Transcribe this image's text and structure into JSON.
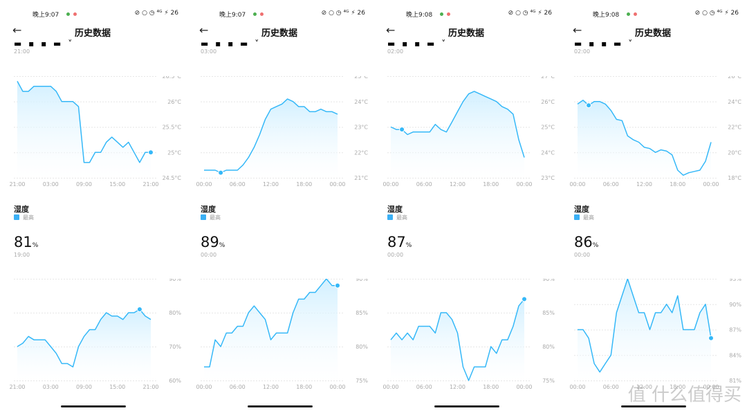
{
  "app": {
    "title": "历史数据",
    "humidity_title": "湿度",
    "legend_max": "最高",
    "humidity_unit": "%",
    "battery": "26",
    "status_icons": "⊘ ○ ◷ ⁴ᴳ ⚡"
  },
  "colors": {
    "line": "#35b8f8",
    "fill_top": "#cdeeff",
    "grid": "#e6e6e6",
    "legend": "#3bb0f5",
    "dot_green": "#4caf50",
    "dot_red": "#ef7070"
  },
  "watermark": "值 什么值得买",
  "panels": [
    {
      "status_time": "晚上9:07",
      "temp_top_time": "21:00",
      "temp_chart": {
        "type": "line",
        "y_ticks": [
          "26.5°C",
          "26°C",
          "25.5°C",
          "25°C",
          "24.5°C"
        ],
        "ylim": [
          24.5,
          26.5
        ],
        "x_ticks": [
          "21:00",
          "03:00",
          "09:00",
          "15:00",
          "21:00"
        ],
        "values": [
          26.4,
          26.2,
          26.2,
          26.3,
          26.3,
          26.3,
          26.3,
          26.2,
          26.0,
          26.0,
          26.0,
          25.9,
          24.8,
          24.8,
          25.0,
          25.0,
          25.2,
          25.3,
          25.2,
          25.1,
          25.2,
          25.0,
          24.8,
          25.0,
          25.0
        ],
        "marker_index": 24
      },
      "humidity_value": "81",
      "humidity_time": "19:00",
      "hum_chart": {
        "type": "line",
        "y_ticks": [
          "90%",
          "80%",
          "70%",
          "60%"
        ],
        "ylim": [
          60,
          90
        ],
        "x_ticks": [
          "21:00",
          "03:00",
          "09:00",
          "15:00",
          "21:00"
        ],
        "values": [
          70,
          71,
          73,
          72,
          72,
          72,
          70,
          68,
          65,
          65,
          64,
          70,
          73,
          75,
          75,
          78,
          80,
          79,
          79,
          78,
          80,
          80,
          81,
          79,
          78
        ],
        "marker_index": 22
      }
    },
    {
      "status_time": "晚上9:07",
      "temp_top_time": "03:00",
      "temp_chart": {
        "type": "line",
        "y_ticks": [
          "25°C",
          "24°C",
          "23°C",
          "22°C",
          "21°C"
        ],
        "ylim": [
          21,
          25
        ],
        "x_ticks": [
          "00:00",
          "06:00",
          "12:00",
          "18:00",
          "00:00"
        ],
        "values": [
          21.3,
          21.3,
          21.3,
          21.2,
          21.3,
          21.3,
          21.3,
          21.5,
          21.8,
          22.2,
          22.7,
          23.3,
          23.7,
          23.8,
          23.9,
          24.1,
          24.0,
          23.8,
          23.8,
          23.6,
          23.6,
          23.7,
          23.6,
          23.6,
          23.5
        ],
        "marker_index": 3
      },
      "humidity_value": "89",
      "humidity_time": "00:00",
      "hum_chart": {
        "type": "line",
        "y_ticks": [
          "90%",
          "85%",
          "80%",
          "75%"
        ],
        "ylim": [
          75,
          90
        ],
        "x_ticks": [
          "00:00",
          "06:00",
          "12:00",
          "18:00",
          "00:00"
        ],
        "values": [
          77,
          77,
          81,
          80,
          82,
          82,
          83,
          83,
          85,
          86,
          85,
          84,
          81,
          82,
          82,
          82,
          85,
          87,
          87,
          88,
          88,
          89,
          90,
          89,
          89
        ],
        "marker_index": 24
      }
    },
    {
      "status_time": "晚上9:08",
      "temp_top_time": "02:00",
      "temp_chart": {
        "type": "line",
        "y_ticks": [
          "27°C",
          "26°C",
          "25°C",
          "24°C",
          "23°C"
        ],
        "ylim": [
          23,
          27
        ],
        "x_ticks": [
          "00:00",
          "06:00",
          "12:00",
          "18:00",
          "00:00"
        ],
        "values": [
          25.0,
          24.9,
          24.9,
          24.7,
          24.8,
          24.8,
          24.8,
          24.8,
          25.1,
          24.9,
          24.8,
          25.2,
          25.6,
          26.0,
          26.3,
          26.4,
          26.3,
          26.2,
          26.1,
          26.0,
          25.8,
          25.7,
          25.5,
          24.5,
          23.8
        ],
        "marker_index": 2
      },
      "humidity_value": "87",
      "humidity_time": "00:00",
      "hum_chart": {
        "type": "line",
        "y_ticks": [
          "90%",
          "85%",
          "80%",
          "75%"
        ],
        "ylim": [
          75,
          90
        ],
        "x_ticks": [
          "00:00",
          "06:00",
          "12:00",
          "18:00",
          "00:00"
        ],
        "values": [
          81,
          82,
          81,
          82,
          81,
          83,
          83,
          83,
          82,
          85,
          85,
          84,
          82,
          77,
          75,
          77,
          77,
          77,
          80,
          79,
          81,
          81,
          83,
          86,
          87
        ],
        "marker_index": 24
      }
    },
    {
      "status_time": "晚上9:08",
      "temp_top_time": "02:00",
      "temp_chart": {
        "type": "line",
        "y_ticks": [
          "26°C",
          "24°C",
          "22°C",
          "20°C",
          "18°C"
        ],
        "ylim": [
          18,
          26
        ],
        "x_ticks": [
          "00:00",
          "06:00",
          "12:00",
          "18:00",
          "00:00"
        ],
        "values": [
          23.8,
          24.1,
          23.7,
          24.0,
          24.0,
          23.8,
          23.3,
          22.6,
          22.5,
          21.3,
          21.0,
          20.8,
          20.4,
          20.3,
          20.0,
          20.2,
          20.1,
          19.8,
          18.6,
          18.2,
          18.4,
          18.5,
          18.6,
          19.3,
          20.8
        ],
        "marker_index": 2
      },
      "humidity_value": "86",
      "humidity_time": "00:00",
      "hum_chart": {
        "type": "line",
        "y_ticks": [
          "93%",
          "90%",
          "87%",
          "84%",
          "81%"
        ],
        "ylim": [
          81,
          93
        ],
        "x_ticks": [
          "00:00",
          "06:00",
          "12:00",
          "18:00",
          "00:00"
        ],
        "values": [
          87,
          87,
          86,
          83,
          82,
          83,
          84,
          89,
          91,
          93,
          91,
          89,
          89,
          87,
          89,
          89,
          90,
          89,
          91,
          87,
          87,
          87,
          89,
          90,
          86
        ],
        "marker_index": 24
      }
    }
  ]
}
